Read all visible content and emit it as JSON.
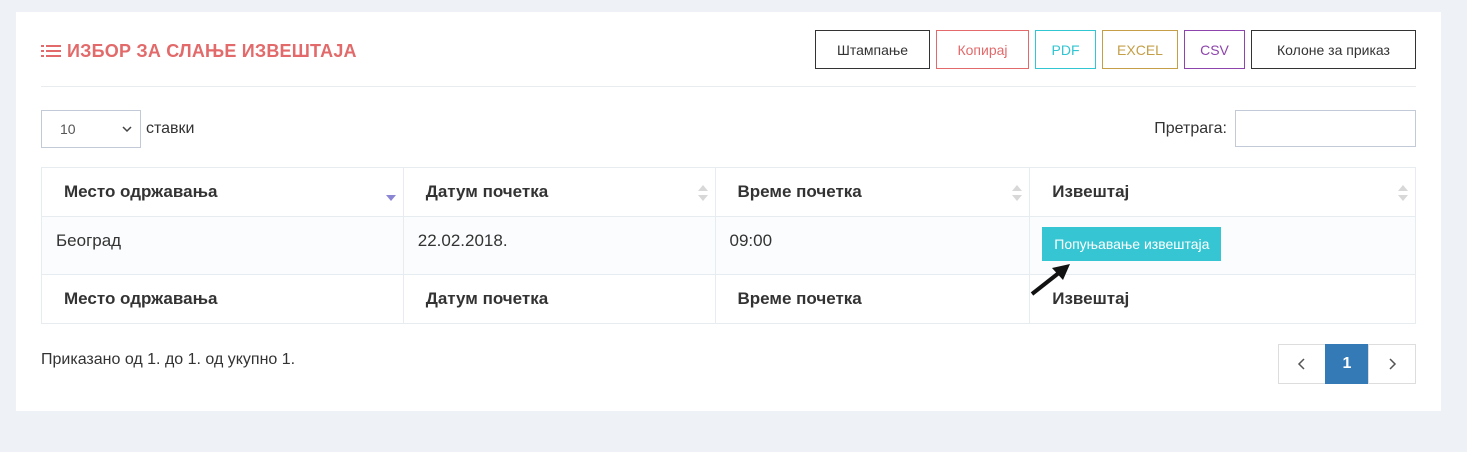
{
  "header": {
    "title": "ИЗБОР ЗА СЛАЊЕ ИЗВЕШТАЈА",
    "buttons": {
      "print": "Штампање",
      "copy": "Копирај",
      "pdf": "PDF",
      "excel": "EXCEL",
      "csv": "CSV",
      "columns": "Колоне за приказ"
    }
  },
  "controls": {
    "page_length": "10",
    "page_length_suffix": "ставки",
    "search_label": "Претрага:",
    "search_value": ""
  },
  "table": {
    "columns": [
      "Место одржавања",
      "Датум почетка",
      "Време почетка",
      "Извештај"
    ],
    "rows": [
      {
        "place": "Београд",
        "date": "22.02.2018.",
        "time": "09:00",
        "action": "Попуњавање извештаја"
      }
    ]
  },
  "footer": {
    "info": "Приказано од 1. до 1. од укупно 1.",
    "current_page": "1"
  },
  "colors": {
    "title": "#e26a6a",
    "primary": "#337ab7",
    "action": "#36c6d3"
  }
}
